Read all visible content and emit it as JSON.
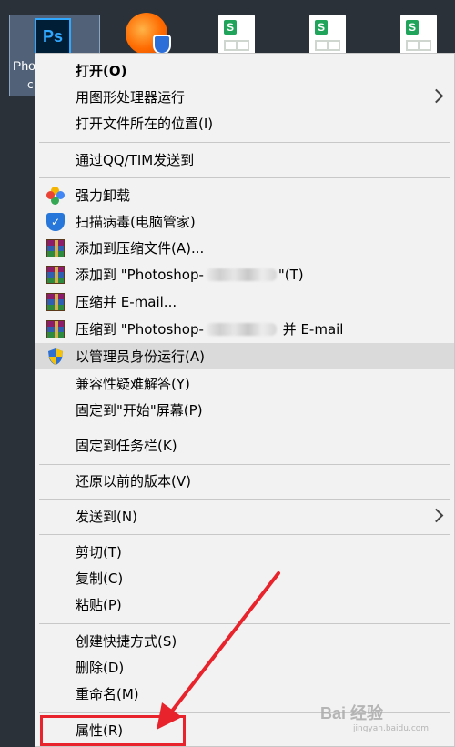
{
  "desktop": {
    "ps_label": "Pho",
    "ps_label2": "c",
    "ps_logo": "Ps",
    "sheet_letter": "S"
  },
  "menu": {
    "items": [
      {
        "label": "打开(O)"
      },
      {
        "label": "用图形处理器运行"
      },
      {
        "label": "打开文件所在的位置(I)"
      },
      {
        "label": "通过QQ/TIM发送到"
      },
      {
        "label": "强力卸载"
      },
      {
        "label": "扫描病毒(电脑管家)"
      },
      {
        "label": "添加到压缩文件(A)..."
      },
      {
        "label_pre": "添加到 \"Photoshop-",
        "label_post": "\"(T)"
      },
      {
        "label": "压缩并 E-mail..."
      },
      {
        "label_pre": "压缩到 \"Photoshop-",
        "label_post": "并 E-mail"
      },
      {
        "label": "以管理员身份运行(A)"
      },
      {
        "label": "兼容性疑难解答(Y)"
      },
      {
        "label": "固定到\"开始\"屏幕(P)"
      },
      {
        "label": "固定到任务栏(K)"
      },
      {
        "label": "还原以前的版本(V)"
      },
      {
        "label": "发送到(N)"
      },
      {
        "label": "剪切(T)"
      },
      {
        "label": "复制(C)"
      },
      {
        "label": "粘贴(P)"
      },
      {
        "label": "创建快捷方式(S)"
      },
      {
        "label": "删除(D)"
      },
      {
        "label": "重命名(M)"
      },
      {
        "label": "属性(R)"
      }
    ]
  },
  "watermark": {
    "main": "Bai 经验",
    "sub": "jingyan.baidu.com"
  },
  "colors": {
    "annotation_red": "#e8232b",
    "hover_bg": "#dadada",
    "menu_bg": "#f2f2f2"
  }
}
